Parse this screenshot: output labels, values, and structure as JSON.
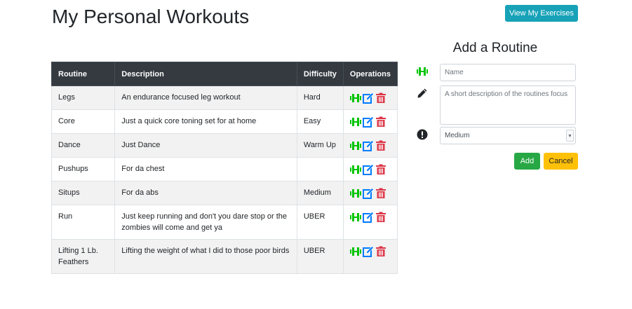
{
  "page": {
    "title": "My Personal Workouts"
  },
  "header": {
    "view_exercises_label": "View My Exercises"
  },
  "table": {
    "columns": [
      "Routine",
      "Description",
      "Difficulty",
      "Operations"
    ],
    "rows": [
      {
        "routine": "Legs",
        "description": "An endurance focused leg workout",
        "difficulty": "Hard"
      },
      {
        "routine": "Core",
        "description": "Just a quick core toning set for at home",
        "difficulty": "Easy"
      },
      {
        "routine": "Dance",
        "description": "Just Dance",
        "difficulty": "Warm Up"
      },
      {
        "routine": "Pushups",
        "description": "For da chest",
        "difficulty": ""
      },
      {
        "routine": "Situps",
        "description": "For da abs",
        "difficulty": "Medium"
      },
      {
        "routine": "Run",
        "description": "Just keep running and don't you dare stop or the zombies will come and get ya",
        "difficulty": "UBER"
      },
      {
        "routine": "Lifting 1 Lb. Feathers",
        "description": "Lifting the weight of what I did to those poor birds",
        "difficulty": "UBER"
      }
    ],
    "operation_icons": [
      "dumbbell-icon",
      "edit-icon",
      "trash-icon"
    ]
  },
  "form": {
    "title": "Add a Routine",
    "name_placeholder": "Name",
    "description_placeholder": "A short description of the routines focus",
    "difficulty_selected": "Medium",
    "add_label": "Add",
    "cancel_label": "Cancel",
    "icons": [
      "dumbbell-icon",
      "pencil-icon",
      "exclamation-circle-icon"
    ]
  },
  "colors": {
    "header_bg": "#343a40",
    "info": "#17a2b8",
    "success": "#28a745",
    "warning": "#ffc107",
    "danger": "#dc3545",
    "primary": "#007bff",
    "icon_green": "#00c400"
  }
}
